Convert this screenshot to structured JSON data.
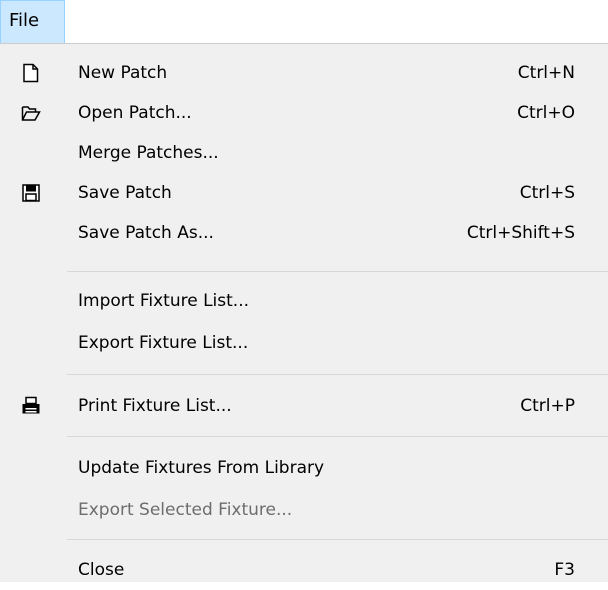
{
  "menubar": {
    "file_label": "File"
  },
  "menu": {
    "items": [
      {
        "label": "New Patch",
        "shortcut": "Ctrl+N",
        "icon": "new-document-icon"
      },
      {
        "label": "Open Patch...",
        "shortcut": "Ctrl+O",
        "icon": "open-folder-icon"
      },
      {
        "label": "Merge Patches...",
        "shortcut": ""
      },
      {
        "label": "Save Patch",
        "shortcut": "Ctrl+S",
        "icon": "save-disk-icon"
      },
      {
        "label": "Save Patch As...",
        "shortcut": "Ctrl+Shift+S"
      },
      {
        "label": "Import Fixture List...",
        "shortcut": ""
      },
      {
        "label": "Export Fixture List...",
        "shortcut": ""
      },
      {
        "label": "Print Fixture List...",
        "shortcut": "Ctrl+P",
        "icon": "printer-icon"
      },
      {
        "label": "Update Fixtures From Library",
        "shortcut": ""
      },
      {
        "label": "Export Selected Fixture...",
        "shortcut": "",
        "disabled": true
      },
      {
        "label": "Close",
        "shortcut": "F3"
      }
    ]
  },
  "colors": {
    "menubar_highlight": "#cce8ff",
    "menu_background": "#f0f0f0",
    "disabled_text": "#6d6d6d"
  }
}
